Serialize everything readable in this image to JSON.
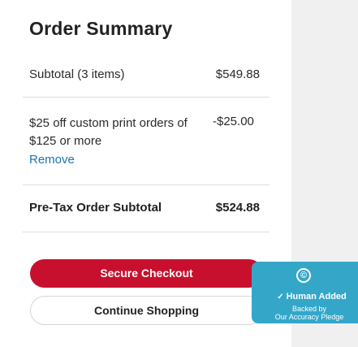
{
  "summary": {
    "title": "Order Summary",
    "subtotal_label": "Subtotal (3 items)",
    "subtotal_value": "$549.88",
    "promo_label": "$25 off custom print orders of $125 or more",
    "promo_value": "-$25.00",
    "remove_label": "Remove",
    "pretax_label": "Pre-Tax Order Subtotal",
    "pretax_value": "$524.88"
  },
  "actions": {
    "checkout_label": "Secure Checkout",
    "continue_label": "Continue Shopping"
  },
  "badge": {
    "title": "Human Added",
    "line1": "Backed by",
    "line2": "Our Accuracy Pledge",
    "color": "#34a7c9"
  },
  "colors": {
    "primary": "#c8102e",
    "link": "#1a73b5"
  }
}
